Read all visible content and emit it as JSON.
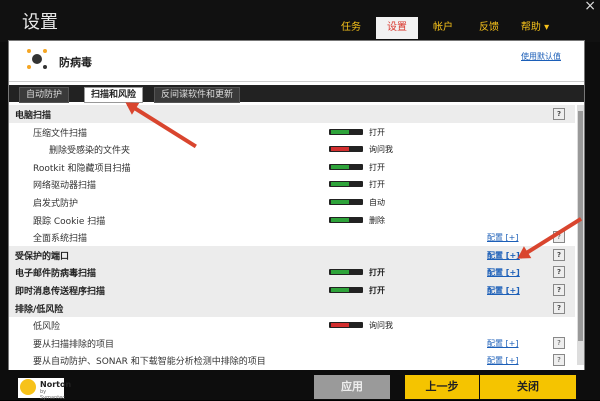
{
  "window": {
    "title": "设置",
    "close_glyph": "×"
  },
  "nav": {
    "tabs": [
      {
        "label": "任务"
      },
      {
        "label": "设置"
      },
      {
        "label": "帐户"
      },
      {
        "label": "反馈"
      },
      {
        "label": "帮助 ▾"
      }
    ]
  },
  "section": {
    "name": "防病毒",
    "defaults_link": "使用默认值"
  },
  "subtabs": [
    {
      "label": "自动防护"
    },
    {
      "label": "扫描和风险"
    },
    {
      "label": "反间谍软件和更新"
    }
  ],
  "rows": [
    {
      "label": "电脑扫描",
      "group": true,
      "help": "?"
    },
    {
      "label": "压缩文件扫描",
      "state": "打开",
      "toggle": "on"
    },
    {
      "label": "删除受感染的文件夹",
      "state": "询问我",
      "toggle": "ask"
    },
    {
      "label": "Rootkit 和隐藏项目扫描",
      "state": "打开",
      "toggle": "on"
    },
    {
      "label": "网络驱动器扫描",
      "state": "打开",
      "toggle": "on"
    },
    {
      "label": "启发式防护",
      "state": "自动",
      "toggle": "auto"
    },
    {
      "label": "跟踪 Cookie 扫描",
      "state": "删除",
      "toggle": "remove"
    },
    {
      "label": "全面系统扫描",
      "config": "配置 [+]",
      "help": "?"
    },
    {
      "label": "受保护的端口",
      "group": true,
      "config": "配置 [+]",
      "help": "?"
    },
    {
      "label": "电子邮件防病毒扫描",
      "group": true,
      "state": "打开",
      "toggle": "on",
      "config": "配置 [+]",
      "help": "?"
    },
    {
      "label": "即时消息传送程序扫描",
      "group": true,
      "state": "打开",
      "toggle": "on",
      "config": "配置 [+]",
      "help": "?"
    },
    {
      "label": "排除/低风险",
      "group": true,
      "help": "?"
    },
    {
      "label": "低风险",
      "state": "询问我",
      "toggle": "ask"
    },
    {
      "label": "要从扫描排除的项目",
      "config": "配置 [+]",
      "help": "?"
    },
    {
      "label": "要从自动防护、SONAR 和下载智能分析检测中排除的项目",
      "config": "配置 [+]",
      "help": "?"
    }
  ],
  "brand": {
    "name": "Norton",
    "sub": "by Symantec"
  },
  "buttons": {
    "apply": "应用",
    "back": "上一步",
    "close": "关闭"
  },
  "colors": {
    "on": "#2ea33a",
    "ask": "#d32f2f",
    "auto": "#2ea33a",
    "remove": "#2ea33a",
    "accent": "#f5c400"
  }
}
